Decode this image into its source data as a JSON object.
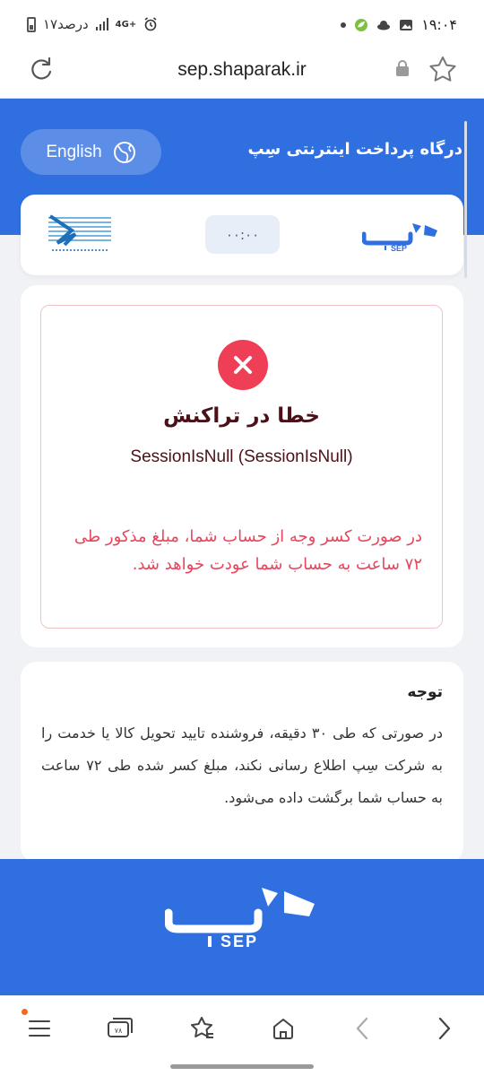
{
  "status_bar": {
    "time": "۱۹:۰۴",
    "date_text": "۱۷درصد",
    "network": "4G+"
  },
  "url_bar": {
    "url": "sep.shaparak.ir"
  },
  "header": {
    "gateway_title": "درگاه پرداخت اینترنتی سِپ",
    "language_button": "English",
    "timer": "۰۰:۰۰",
    "brand": "SEP"
  },
  "error": {
    "title": "خطا در تراکنش",
    "detail": "SessionIsNull (SessionIsNull)",
    "note": "در صورت کسر وجه از حساب شما، مبلغ مذکور طی ۷۲ ساعت به حساب شما عودت خواهد شد."
  },
  "notice": {
    "title": "توجه",
    "body": "در صورتی که طی ۳۰ دقیقه، فروشنده تایید تحویل کالا یا خدمت را به شرکت سِپ اطلاع رسانی نکند، مبلغ کسر شده طی ۷۲ ساعت به حساب شما برگشت داده می‌شود."
  },
  "footer": {
    "brand": "SEP"
  },
  "bottom_bar": {
    "tabs_count": "۷۸"
  },
  "colors": {
    "brand_blue": "#2f6fe0",
    "error_red": "#ef3f57",
    "error_text": "#e8455c",
    "title_dark": "#4a1218"
  }
}
